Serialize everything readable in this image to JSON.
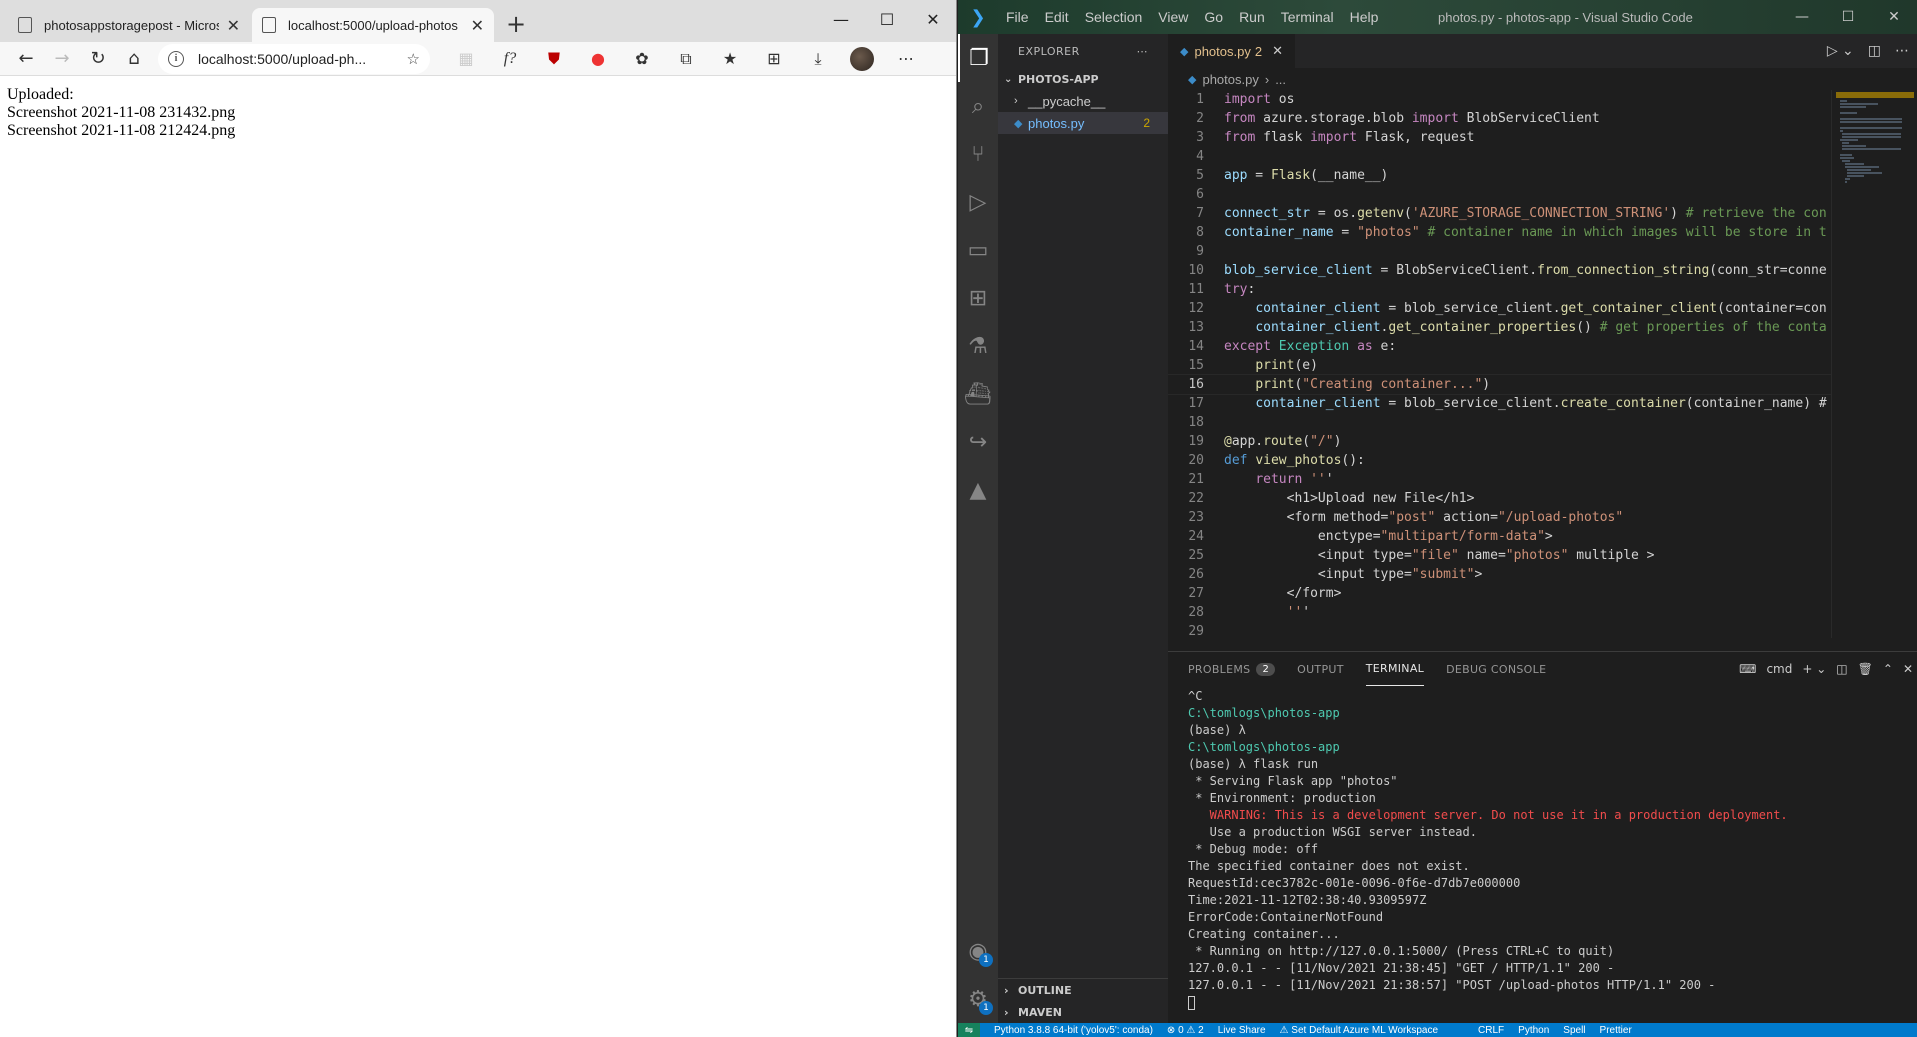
{
  "browser": {
    "tabs": [
      {
        "title": "photosappstoragepost - Microso",
        "active": false
      },
      {
        "title": "localhost:5000/upload-photos",
        "active": true
      }
    ],
    "address": "localhost:5000/upload-ph...",
    "page_lines": [
      "Uploaded:",
      "Screenshot 2021-11-08 231432.png",
      "Screenshot 2021-11-08 212424.png"
    ]
  },
  "vscode": {
    "menu": [
      "File",
      "Edit",
      "Selection",
      "View",
      "Go",
      "Run",
      "Terminal",
      "Help"
    ],
    "window_title": "photos.py - photos-app - Visual Studio Code",
    "explorer": {
      "header": "EXPLORER",
      "folder": "PHOTOS-APP",
      "items": [
        {
          "name": "__pycache__",
          "type": "folder"
        },
        {
          "name": "photos.py",
          "type": "file",
          "problems": "2"
        }
      ],
      "outline": "OUTLINE",
      "maven": "MAVEN"
    },
    "editor_tab": {
      "name": "photos.py",
      "problems": "2"
    },
    "breadcrumb": {
      "file": "photos.py",
      "rest": "..."
    },
    "code_lines": [
      "import os",
      "from azure.storage.blob import BlobServiceClient",
      "from flask import Flask, request",
      "",
      "app = Flask(__name__)",
      "",
      "connect_str = os.getenv('AZURE_STORAGE_CONNECTION_STRING') # retrieve the con",
      "container_name = \"photos\" # container name in which images will be store in t",
      "",
      "blob_service_client = BlobServiceClient.from_connection_string(conn_str=conne",
      "try:",
      "    container_client = blob_service_client.get_container_client(container=con",
      "    container_client.get_container_properties() # get properties of the conta",
      "except Exception as e:",
      "    print(e)",
      "    print(\"Creating container...\")",
      "    container_client = blob_service_client.create_container(container_name) #",
      "",
      "@app.route(\"/\")",
      "def view_photos():",
      "    return '''",
      "        <h1>Upload new File</h1>",
      "        <form method=\"post\" action=\"/upload-photos\"",
      "            enctype=\"multipart/form-data\">",
      "            <input type=\"file\" name=\"photos\" multiple >",
      "            <input type=\"submit\">",
      "        </form>",
      "        '''",
      ""
    ],
    "current_line": 16,
    "panel": {
      "tabs": [
        "PROBLEMS",
        "OUTPUT",
        "TERMINAL",
        "DEBUG CONSOLE"
      ],
      "problems_count": "2",
      "active": "TERMINAL",
      "shell": "cmd"
    },
    "terminal_lines": [
      {
        "t": "^C",
        "k": "n"
      },
      {
        "t": "C:\\tomlogs\\photos-app",
        "k": "path"
      },
      {
        "t": "(base) λ",
        "k": "n"
      },
      {
        "t": "C:\\tomlogs\\photos-app",
        "k": "path"
      },
      {
        "t": "(base) λ flask run",
        "k": "n"
      },
      {
        "t": " * Serving Flask app \"photos\"",
        "k": "n"
      },
      {
        "t": " * Environment: production",
        "k": "n"
      },
      {
        "t": "   WARNING: This is a development server. Do not use it in a production deployment.",
        "k": "warn"
      },
      {
        "t": "   Use a production WSGI server instead.",
        "k": "n"
      },
      {
        "t": " * Debug mode: off",
        "k": "n"
      },
      {
        "t": "The specified container does not exist.",
        "k": "n"
      },
      {
        "t": "RequestId:cec3782c-001e-0096-0f6e-d7db7e000000",
        "k": "n"
      },
      {
        "t": "Time:2021-11-12T02:38:40.9309597Z",
        "k": "n"
      },
      {
        "t": "ErrorCode:ContainerNotFound",
        "k": "n"
      },
      {
        "t": "Creating container...",
        "k": "n"
      },
      {
        "t": " * Running on http://127.0.0.1:5000/ (Press CTRL+C to quit)",
        "k": "n"
      },
      {
        "t": "127.0.0.1 - - [11/Nov/2021 21:38:45] \"GET / HTTP/1.1\" 200 -",
        "k": "n"
      },
      {
        "t": "127.0.0.1 - - [11/Nov/2021 21:38:57] \"POST /upload-photos HTTP/1.1\" 200 -",
        "k": "n"
      }
    ],
    "statusbar": [
      "Python 3.8.8 64-bit ('yolov5': conda)",
      "⊗ 0 ⚠ 2",
      "Live Share",
      "⚠ Set Default Azure ML Workspace",
      "CRLF",
      "Python",
      "Spell",
      "Prettier"
    ],
    "account_badge": "1",
    "settings_badge": "1"
  }
}
